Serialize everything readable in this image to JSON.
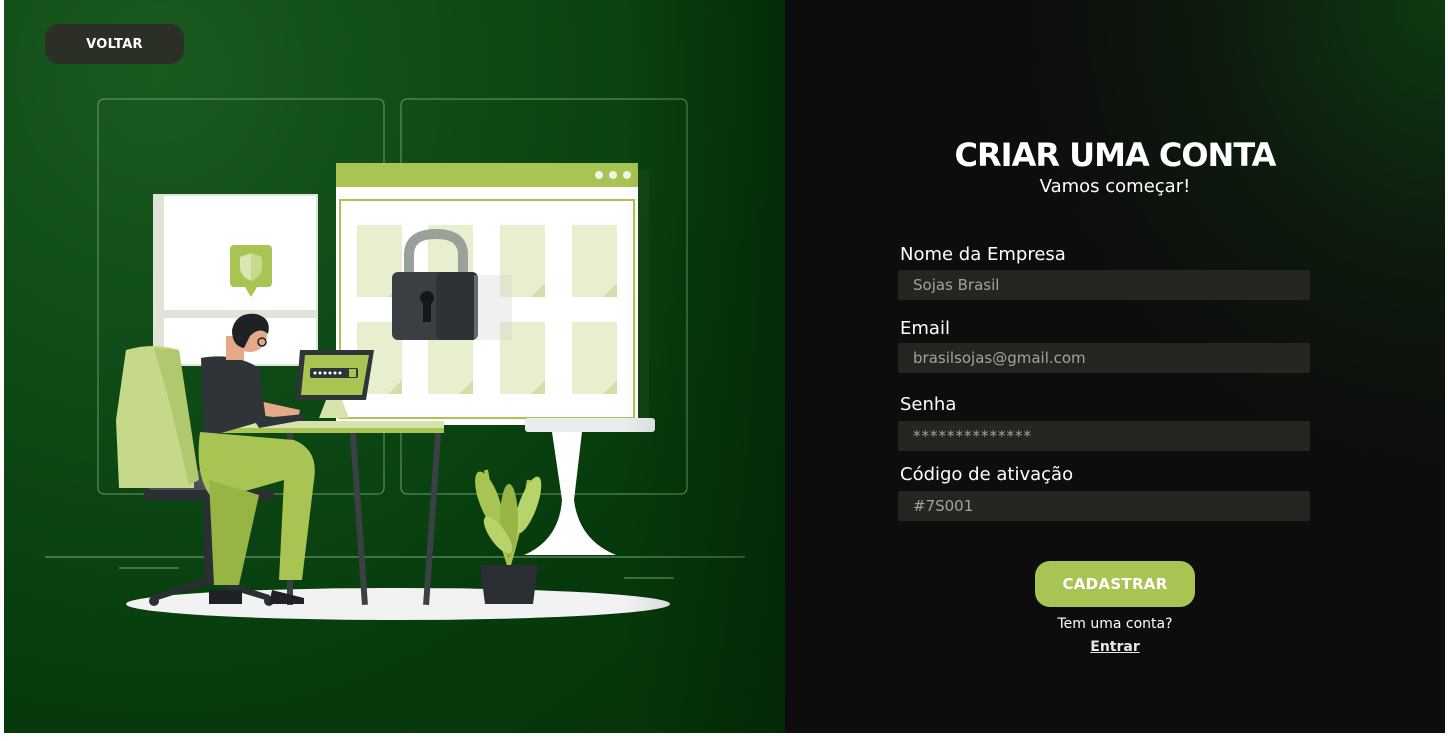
{
  "nav": {
    "back_label": "VOLTAR"
  },
  "form": {
    "title": "CRIAR UMA CONTA",
    "subtitle": "Vamos começar!",
    "fields": [
      {
        "label": "Nome da Empresa",
        "value": "Sojas Brasil"
      },
      {
        "label": "Email",
        "value": "brasilsojas@gmail.com"
      },
      {
        "label": "Senha",
        "value": "**************"
      },
      {
        "label": "Código de ativação",
        "value": "#7S001"
      }
    ],
    "submit_label": "CADASTRAR",
    "has_account_text": "Tem uma conta?",
    "login_link": "Entrar"
  },
  "colors": {
    "left_bg": "#0e4a16",
    "right_bg": "#0d0d0d",
    "accent": "#a8c452",
    "input_bg": "#24261f"
  },
  "illustration": {
    "icon": "person-at-desk-with-lock-illustration"
  }
}
